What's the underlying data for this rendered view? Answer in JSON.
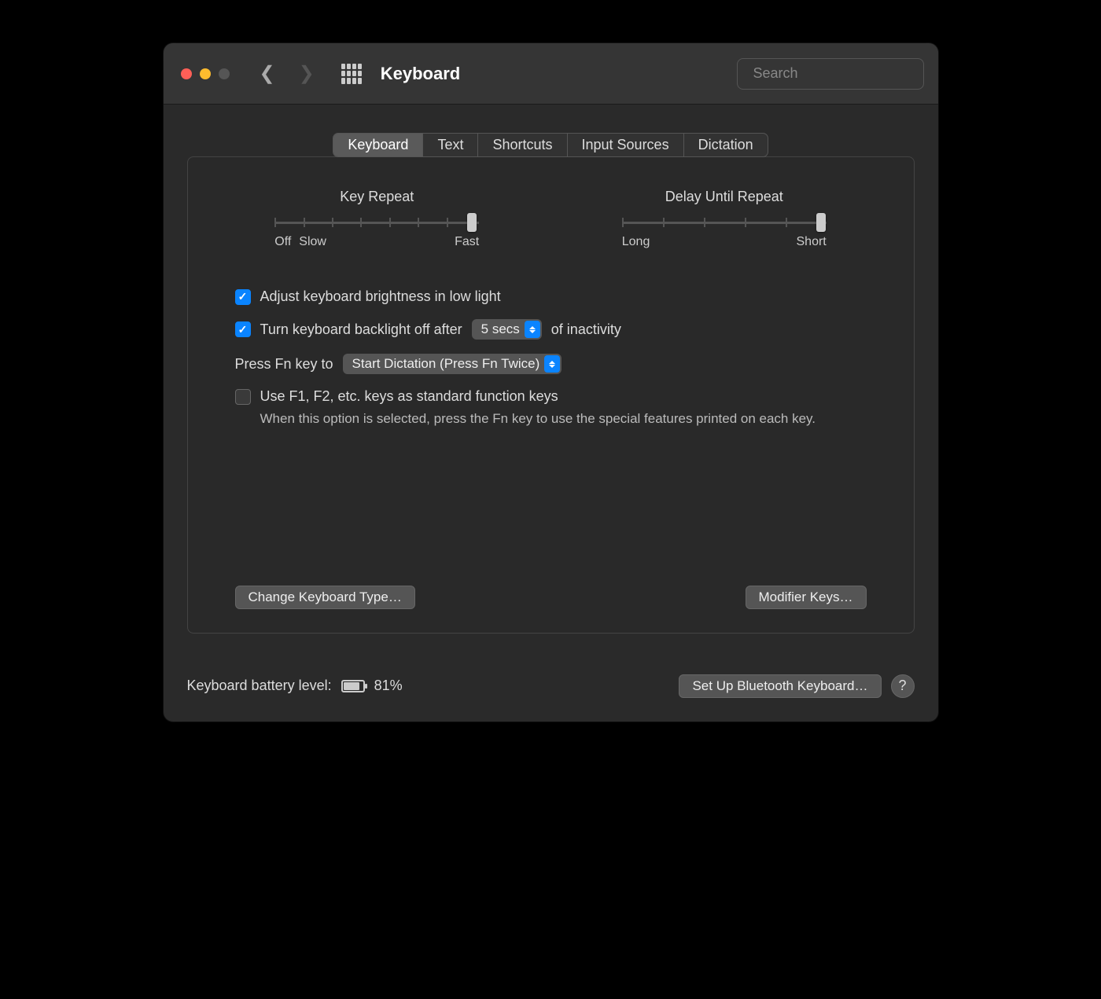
{
  "window": {
    "title": "Keyboard"
  },
  "search": {
    "placeholder": "Search"
  },
  "tabs": [
    "Keyboard",
    "Text",
    "Shortcuts",
    "Input Sources",
    "Dictation"
  ],
  "sliders": {
    "key_repeat": {
      "title": "Key Repeat",
      "labels": {
        "off": "Off",
        "slow": "Slow",
        "fast": "Fast"
      }
    },
    "delay": {
      "title": "Delay Until Repeat",
      "labels": {
        "long": "Long",
        "short": "Short"
      }
    }
  },
  "options": {
    "adjust_brightness": "Adjust keyboard brightness in low light",
    "backlight_prefix": "Turn keyboard backlight off after",
    "backlight_select": "5 secs",
    "backlight_suffix": "of inactivity",
    "fn_prefix": "Press Fn key to",
    "fn_select": "Start Dictation (Press Fn Twice)",
    "standard_fn": "Use F1, F2, etc. keys as standard function keys",
    "standard_fn_help": "When this option is selected, press the Fn key to use the special features printed on each key."
  },
  "buttons": {
    "change_type": "Change Keyboard Type…",
    "modifier": "Modifier Keys…",
    "bluetooth": "Set Up Bluetooth Keyboard…"
  },
  "footer": {
    "battery_label": "Keyboard battery level:",
    "battery_pct": "81%"
  }
}
